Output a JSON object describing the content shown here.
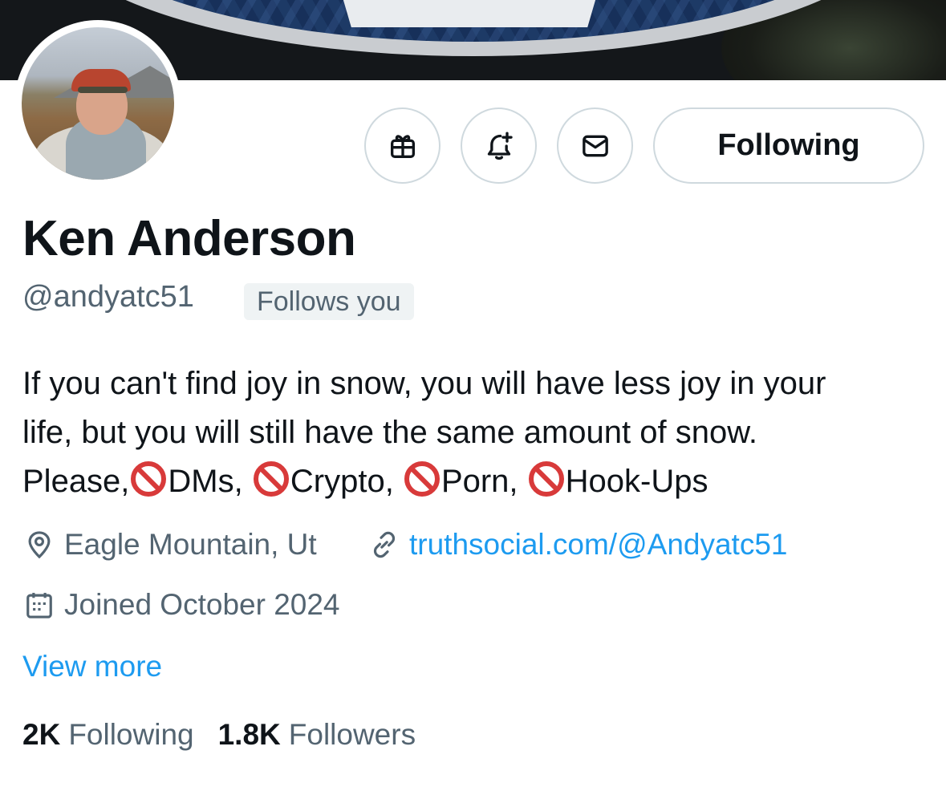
{
  "profile": {
    "name": "Ken Anderson",
    "handle": "@andyatc51",
    "follows_you_badge": "Follows you",
    "bio_lines": [
      "If you can't find joy in snow, you will have less joy in your",
      "life, but you will still have the same amount of snow."
    ],
    "bio_line3": {
      "please": "Please,",
      "dms": "DMs,",
      "crypto": "Crypto,",
      "porn": "Porn,",
      "hookups": "Hook-Ups"
    },
    "location": "Eagle Mountain, Ut",
    "website": "truthsocial.com/@Andyatc51",
    "joined": "Joined October 2024",
    "view_more": "View more",
    "stats": {
      "following_count": "2K",
      "following_label": "Following",
      "followers_count": "1.8K",
      "followers_label": "Followers"
    }
  },
  "actions": {
    "gift_icon": "gift-icon",
    "notify_icon": "bell-plus-icon",
    "message_icon": "envelope-icon",
    "follow_label": "Following"
  },
  "colors": {
    "link": "#1d9bf0",
    "secondary_text": "#536471",
    "primary_text": "#0f1419",
    "prohibited": "#d83a3a"
  }
}
